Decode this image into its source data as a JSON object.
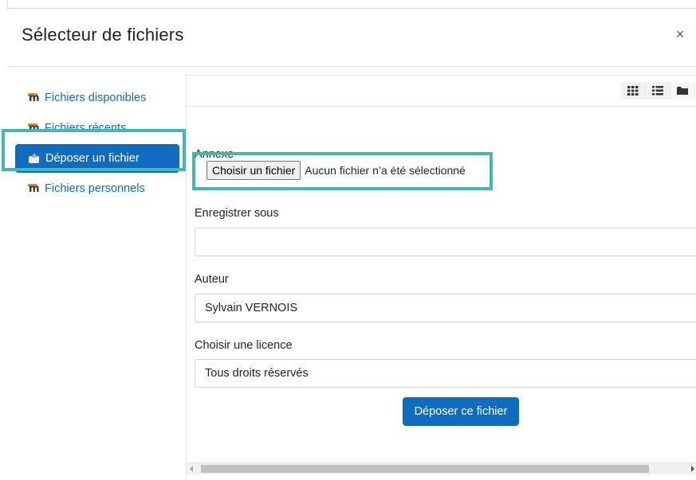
{
  "dialog": {
    "title": "Sélecteur de fichiers",
    "close_glyph": "×"
  },
  "sidebar": {
    "items": [
      {
        "label": "Fichiers disponibles",
        "icon": "moodle-icon"
      },
      {
        "label": "Fichiers récents",
        "icon": "moodle-icon"
      },
      {
        "label": "Déposer un fichier",
        "icon": "upload-icon",
        "active": true
      },
      {
        "label": "Fichiers personnels",
        "icon": "moodle-icon"
      }
    ]
  },
  "toolbar": {
    "views": [
      "grid-view-icon",
      "list-view-icon",
      "folder-view-icon"
    ]
  },
  "form": {
    "attachment_label": "Annexe",
    "choose_file_label": "Choisir un fichier",
    "file_status": "Aucun fichier n’a été sélectionné",
    "save_as_label": "Enregistrer sous",
    "save_as_value": "",
    "author_label": "Auteur",
    "author_value": "Sylvain VERNOIS",
    "license_label": "Choisir une licence",
    "license_value": "Tous droits réservés",
    "submit_label": "Déposer ce fichier"
  },
  "colors": {
    "accent": "#0f6cbf",
    "highlight": "#3fb8b8"
  }
}
